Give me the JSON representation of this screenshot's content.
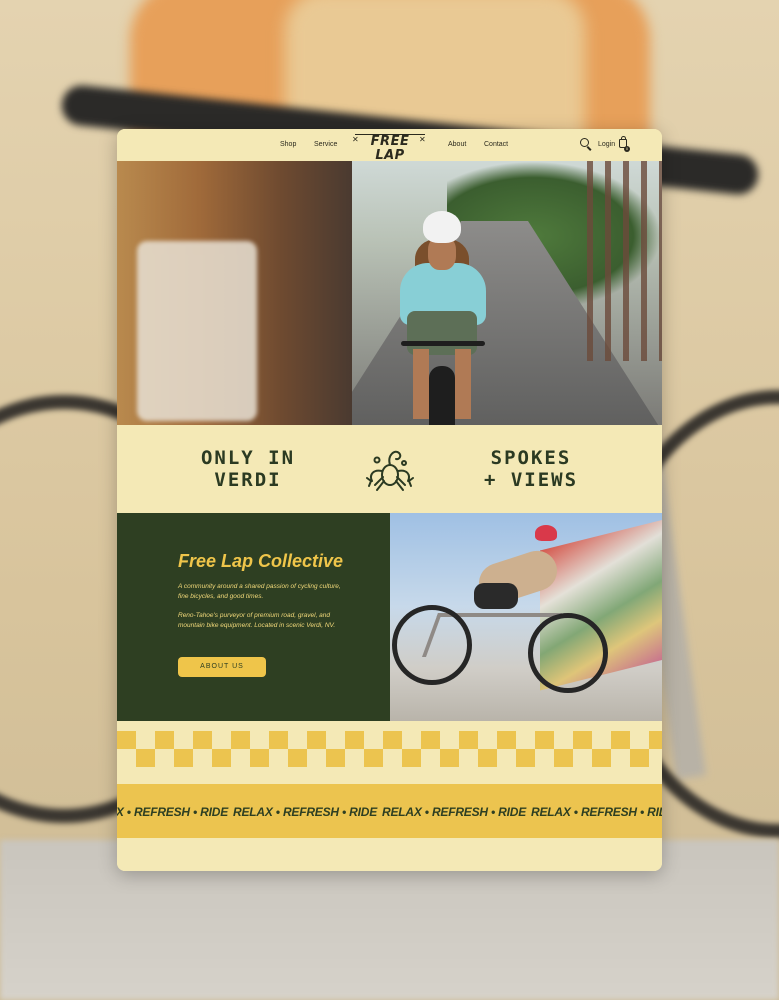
{
  "nav": {
    "left_links": [
      "Shop",
      "Service"
    ],
    "right_links": [
      "About",
      "Contact"
    ],
    "logo": {
      "name": "FREE LAP",
      "tagline": "RELAX · REFRESH · RIDE"
    },
    "login_label": "Login",
    "cart_count": "0",
    "icons": [
      "search-icon",
      "cart-icon"
    ]
  },
  "banner": {
    "left": [
      "ONLY IN",
      "VERDI"
    ],
    "right": [
      "SPOKES",
      "+ VIEWS"
    ]
  },
  "collective": {
    "title": "Free Lap Collective",
    "paragraph_1": "A community around a shared passion of cycling culture, fine bicycles, and good times.",
    "paragraph_2": "Reno-Tahoe's purveyor of premium road, gravel, and mountain bike equipment. Located in scenic Verdi, NV.",
    "button_label": "ABOUT US"
  },
  "marquee": {
    "items": [
      "RELAX • REFRESH • RIDE",
      "RELAX • REFRESH • RIDE",
      "RELAX • REFRESH • RIDE",
      "RELAX • REFRESH • RIDE"
    ]
  },
  "colors": {
    "cream": "#f4e9b6",
    "forest": "#2e3f22",
    "mustard": "#ecc44f"
  }
}
